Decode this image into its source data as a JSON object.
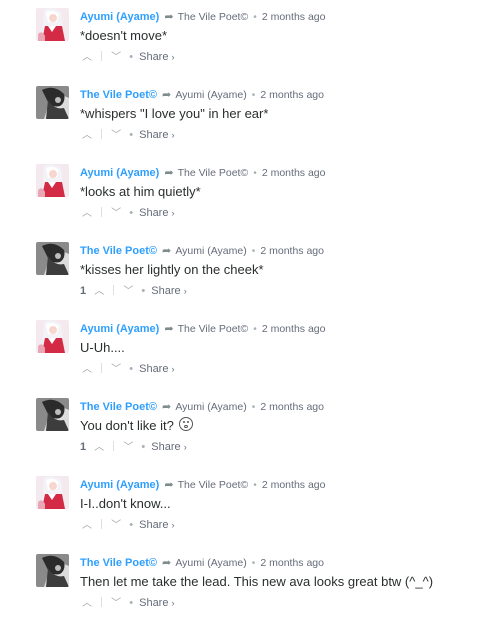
{
  "comments": [
    {
      "author": "Ayumi (Ayame)",
      "avatar": "anime-avatar",
      "reply_to": "The Vile Poet©",
      "time": "2 months ago",
      "text": "*doesn't move*",
      "votes": "",
      "share": "Share",
      "emoji": false
    },
    {
      "author": "The Vile Poet©",
      "avatar": "dark-avatar",
      "reply_to": "Ayumi (Ayame)",
      "time": "2 months ago",
      "text": "*whispers \"I love you\" in her ear*",
      "votes": "",
      "share": "Share",
      "emoji": false
    },
    {
      "author": "Ayumi (Ayame)",
      "avatar": "anime-avatar",
      "reply_to": "The Vile Poet©",
      "time": "2 months ago",
      "text": "*looks at him quietly*",
      "votes": "",
      "share": "Share",
      "emoji": false
    },
    {
      "author": "The Vile Poet©",
      "avatar": "dark-avatar",
      "reply_to": "Ayumi (Ayame)",
      "time": "2 months ago",
      "text": "*kisses her lightly on the cheek*",
      "votes": "1",
      "share": "Share",
      "emoji": false
    },
    {
      "author": "Ayumi (Ayame)",
      "avatar": "anime-avatar",
      "reply_to": "The Vile Poet©",
      "time": "2 months ago",
      "text": "U-Uh....",
      "votes": "",
      "share": "Share",
      "emoji": false
    },
    {
      "author": "The Vile Poet©",
      "avatar": "dark-avatar",
      "reply_to": "Ayumi (Ayame)",
      "time": "2 months ago",
      "text": "You don't like it?",
      "votes": "1",
      "share": "Share",
      "emoji": true
    },
    {
      "author": "Ayumi (Ayame)",
      "avatar": "anime-avatar",
      "reply_to": "The Vile Poet©",
      "time": "2 months ago",
      "text": "I-I..don't know...",
      "votes": "",
      "share": "Share",
      "emoji": false
    },
    {
      "author": "The Vile Poet©",
      "avatar": "dark-avatar",
      "reply_to": "Ayumi (Ayame)",
      "time": "2 months ago",
      "text": "Then let me take the lead. This new ava looks great btw (^_^)",
      "votes": "",
      "share": "Share",
      "emoji": false
    }
  ],
  "colors": {
    "author": "#2e9fff",
    "meta": "#656c7a",
    "text": "#2a2e2e"
  }
}
